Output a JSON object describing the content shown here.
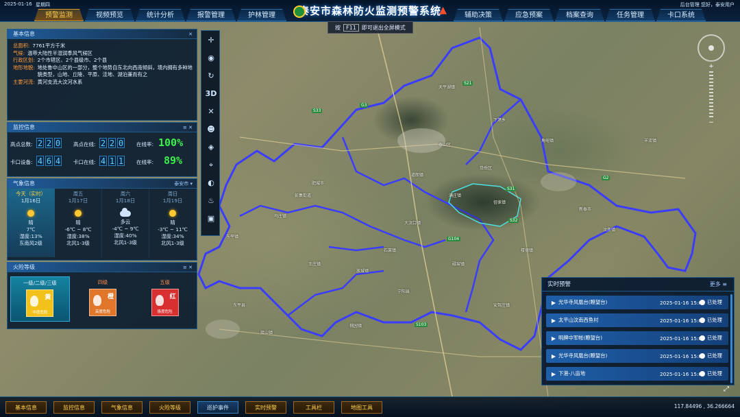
{
  "header": {
    "date": "2025-01-16",
    "weekday": "星期四",
    "title": "泰安市森林防火监测预警系统",
    "right_info": "后台管理    您好，泰安用户",
    "left_tabs": [
      "预警监测",
      "视频预览",
      "统计分析",
      "报警管理",
      "护林管理"
    ],
    "right_tabs": [
      "辅助决策",
      "应急预案",
      "档案查询",
      "任务管理",
      "卡口系统"
    ]
  },
  "fullscreen_hint": {
    "prefix": "按",
    "key": "F11",
    "suffix": "即可退出全屏模式"
  },
  "basic_info": {
    "title": "基本信息",
    "rows": [
      {
        "k": "总面积:",
        "v": "7761平方千米"
      },
      {
        "k": "气候:",
        "v": "温带大陆性半湿润季风气候区"
      },
      {
        "k": "行政区划:",
        "v": "2个市辖区、2个县级市、2个县"
      },
      {
        "k": "地形地貌:",
        "v": "地处鲁中山区的一部分，整个地势自东北向西南倾斜，境内拥有多种地貌类型，山地、丘陵、平原、洼地、湖泊兼而有之"
      },
      {
        "k": "主要河流:",
        "v": "黄河支流大汶河水系"
      }
    ]
  },
  "monitor_info": {
    "title": "监控信息",
    "labels": {
      "total": "高点总数:",
      "online": "高点在线:",
      "rate1": "在线率:",
      "gate": "卡口设备:",
      "gate_online": "卡口在线:",
      "rate2": "在线率:"
    },
    "total": "220",
    "online": "220",
    "rate1": "100%",
    "gate": "464",
    "gate_online": "411",
    "rate2": "89%"
  },
  "weather": {
    "title": "气象信息",
    "city": "泰安市",
    "days": [
      {
        "name": "今天（实时）",
        "date": "1月16日",
        "icon": "sun-icon",
        "cond": "晴",
        "temp": "7℃",
        "hum": "湿度:13%",
        "wind": "东南风2级"
      },
      {
        "name": "周五",
        "date": "1月17日",
        "icon": "sun-icon",
        "cond": "晴",
        "temp": "-6℃ ~ 8℃",
        "hum": "湿度:38%",
        "wind": "北风1-3级"
      },
      {
        "name": "周六",
        "date": "1月18日",
        "icon": "cloud-icon",
        "cond": "多云",
        "temp": "-4℃ ~ 9℃",
        "hum": "湿度:40%",
        "wind": "北风1-3级"
      },
      {
        "name": "周日",
        "date": "1月19日",
        "icon": "sun-icon",
        "cond": "晴",
        "temp": "-3℃ ~ 11℃",
        "hum": "湿度:34%",
        "wind": "北风1-3级"
      }
    ]
  },
  "fire_level": {
    "title": "火险等级",
    "levels": [
      {
        "label": "一级/二级/三级",
        "char": "黄",
        "sub": "中度危险",
        "color": "#f2c21a"
      },
      {
        "label": "四级",
        "char": "橙",
        "sub": "高度危险",
        "color": "#e0762a"
      },
      {
        "label": "五级",
        "char": "红",
        "sub": "极度危险",
        "color": "#d83030"
      }
    ]
  },
  "toolbar": {
    "tools": [
      "move-icon",
      "locate-icon",
      "measure-icon",
      "3D",
      "satellite-icon",
      "person-icon",
      "layer-icon",
      "focus-icon",
      "eye-icon",
      "fire-icon",
      "screen-icon"
    ],
    "label_3d": "3D"
  },
  "alerts": {
    "title": "实时预警",
    "more": "更多",
    "items": [
      {
        "loc": "光华寺风凰台(瞭望台)",
        "time": "2025-01-16 15:07",
        "status": "已处理"
      },
      {
        "loc": "太平山汶南西鱼村",
        "time": "2025-01-16 15:04",
        "status": "已处理"
      },
      {
        "loc": "明牌中军帐(瞭望台)",
        "time": "2025-01-16 15:06",
        "status": "已处理"
      },
      {
        "loc": "光华寺风凰台(瞭望台)",
        "time": "2025-01-16 15:06",
        "status": "已处理"
      },
      {
        "loc": "下港-八亩地",
        "time": "2025-01-16 15:05",
        "status": "已处理"
      }
    ]
  },
  "bottom_tabs": [
    "基本信息",
    "监控信息",
    "气象信息",
    "火险等级",
    "巡护事件",
    "实时预警",
    "工具栏",
    "地图工具"
  ],
  "coords": "117.84496 , 36.266664",
  "map_labels": {
    "places": [
      "天平湖镇",
      "泰山区",
      "岱岳区",
      "满庄镇",
      "徂徕镇",
      "新泰市",
      "肥城市",
      "宁阳县",
      "东平县",
      "汶南镇",
      "楼德镇",
      "角峪镇",
      "大汶口镇",
      "石莱镇",
      "放城镇",
      "磁窑镇",
      "马庄镇",
      "安驾庄镇",
      "王庄镇",
      "桃园镇",
      "东平镇",
      "接山镇",
      "彭集街道",
      "羊流镇",
      "下港乡",
      "道朗镇"
    ],
    "roads": [
      "G3",
      "S31",
      "G2",
      "S33",
      "S21",
      "G104",
      "S103",
      "S104",
      "S32"
    ]
  }
}
